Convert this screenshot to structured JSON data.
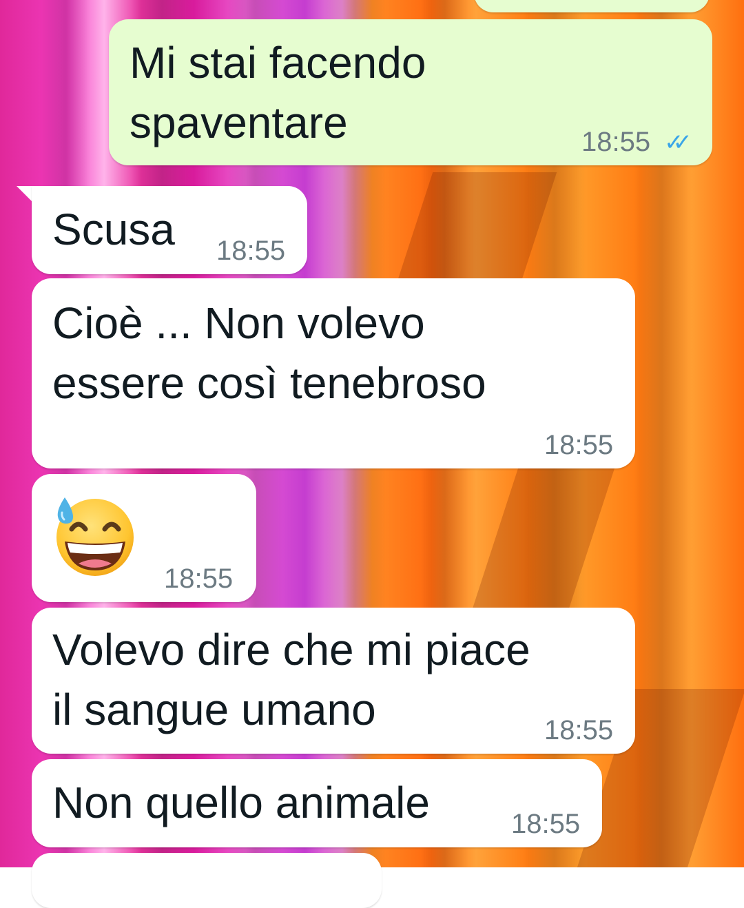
{
  "messages": [
    {
      "id": "m0",
      "direction": "out",
      "text": "",
      "time": ""
    },
    {
      "id": "m1",
      "direction": "out",
      "text": "Mi stai facendo\nspaventare",
      "time": "18:55",
      "status_icon": "double-check-read-icon",
      "status_glyph": "✓✓"
    },
    {
      "id": "m2",
      "direction": "in",
      "text": "Scusa",
      "time": "18:55"
    },
    {
      "id": "m3",
      "direction": "in",
      "text": "Cioè ... Non volevo\nessere così tenebroso",
      "time": "18:55"
    },
    {
      "id": "m4",
      "direction": "in",
      "emoji": "grinning-face-with-sweat-icon",
      "time": "18:55"
    },
    {
      "id": "m5",
      "direction": "in",
      "text": "Volevo dire che mi piace\nil sangue umano",
      "time": "18:55"
    },
    {
      "id": "m6",
      "direction": "in",
      "text": "Non quello animale",
      "time": "18:55"
    },
    {
      "id": "m7",
      "direction": "in",
      "text": "",
      "time": ""
    }
  ],
  "colors": {
    "outgoing_bubble": "#e6fdd0",
    "incoming_bubble": "#ffffff",
    "read_ticks": "#3aa5e8",
    "timestamp": "#6c7a82"
  }
}
